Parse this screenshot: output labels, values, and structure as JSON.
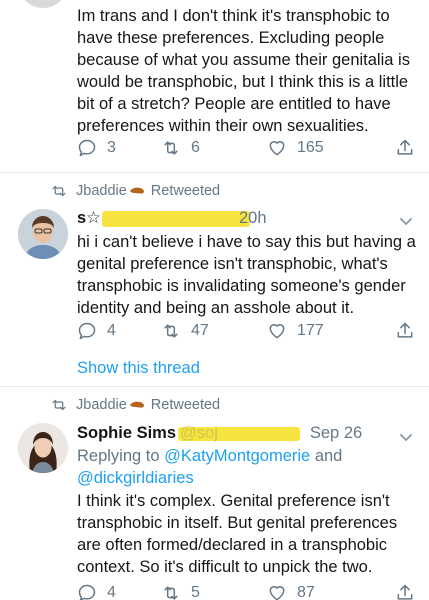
{
  "tweet1": {
    "text": "Im trans and I don't think it's transphobic to have these preferences. Excluding people because of what you assume their genitalia is would be transphobic, but I think this is a little bit of a stretch? People are entitled to have preferences within their own sexualities.",
    "reply_count": "3",
    "retweet_count": "6",
    "like_count": "165"
  },
  "tweet2": {
    "retweeted_by": "Jbaddie",
    "retweeted_label": "Retweeted",
    "name": "s☆",
    "time": "20h",
    "text": "hi i can't believe i have to say this but having a genital preference isn't transphobic, what's transphobic is invalidating someone's gender identity and being an asshole about it.",
    "reply_count": "4",
    "retweet_count": "47",
    "like_count": "177",
    "show_thread": "Show this thread"
  },
  "tweet3": {
    "retweeted_by": "Jbaddie",
    "retweeted_label": "Retweeted",
    "name": "Sophie Sims",
    "handle": "@soj",
    "time": "Sep 26",
    "replying_prefix": "Replying to",
    "replying_to_1": "@KatyMontgomerie",
    "replying_and": "and",
    "replying_to_2": "@dickgirldiaries",
    "text": "I think it's complex. Genital preference isn't transphobic in itself. But genital preferences are often formed/declared in a transphobic context. So it's difficult to unpick the two.",
    "reply_count": "4",
    "retweet_count": "5",
    "like_count": "87"
  },
  "colors": {
    "link": "#1da1f2",
    "muted": "#657786",
    "highlight": "#f6e233"
  }
}
